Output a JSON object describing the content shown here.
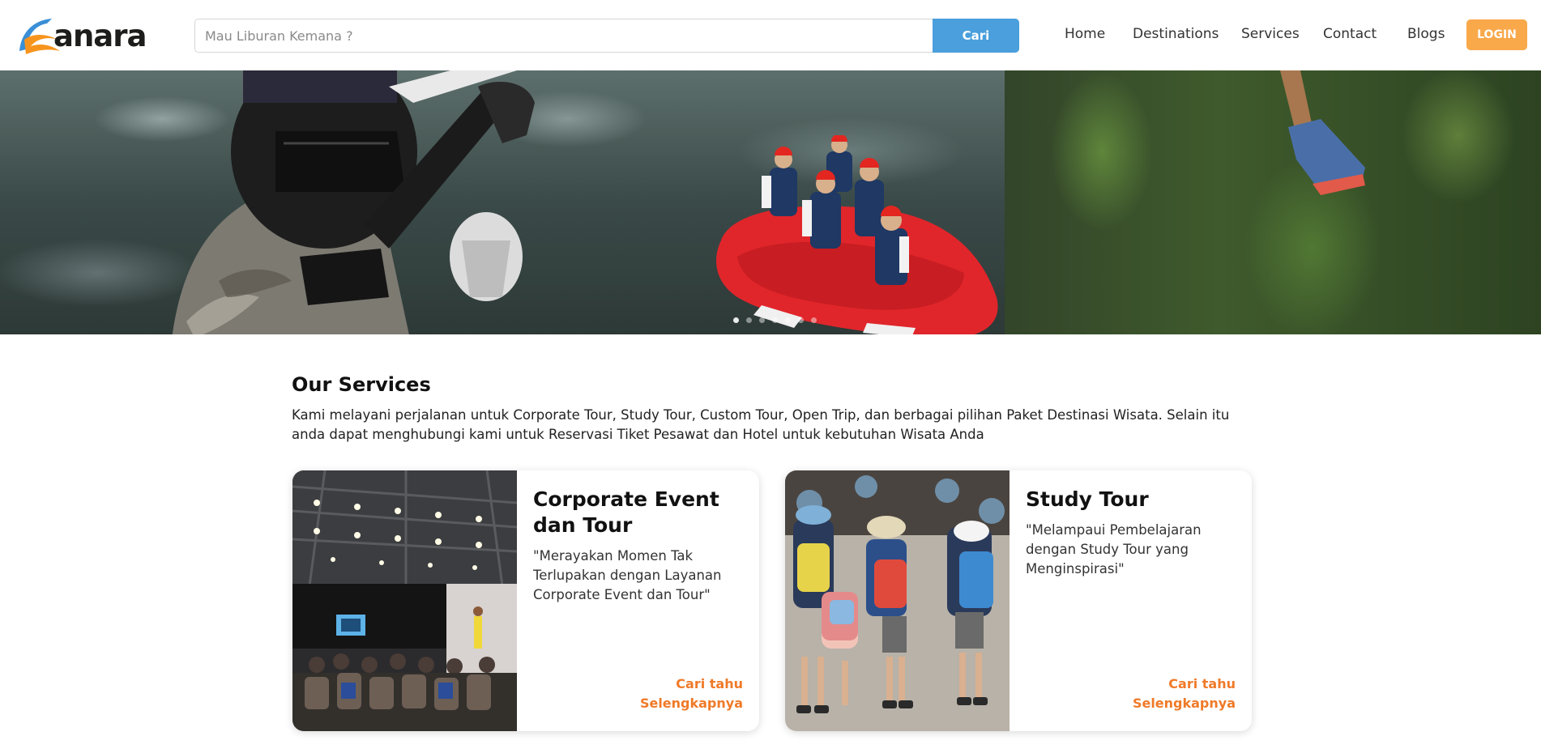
{
  "brand": {
    "name": "anara",
    "accent_orange": "#f7941d",
    "accent_blue": "#3a8fd6"
  },
  "search": {
    "placeholder": "Mau Liburan Kemana ?",
    "value": "",
    "button_label": "Cari"
  },
  "nav": {
    "items": [
      "Home",
      "Destinations",
      "Services",
      "Contact",
      "Blogs"
    ],
    "login_label": "LOGIN"
  },
  "hero": {
    "slide_count": 7,
    "active_slide": 1
  },
  "services": {
    "title": "Our Services",
    "description": "Kami melayani perjalanan untuk Corporate Tour, Study Tour, Custom Tour, Open Trip, dan berbagai pilihan Paket Destinasi Wisata. Selain itu anda dapat menghubungi kami untuk Reservasi Tiket Pesawat dan Hotel untuk kebutuhan Wisata Anda",
    "cards": [
      {
        "title": "Corporate Event dan Tour",
        "quote": "\"Merayakan Momen Tak Terlupakan dengan Layanan Corporate Event dan Tour\"",
        "link_line1": "Cari tahu",
        "link_line2": "Selengkapnya"
      },
      {
        "title": "Study Tour",
        "quote": "\"Melampaui Pembelajaran dengan Study Tour yang Menginspirasi\"",
        "link_line1": "Cari tahu",
        "link_line2": "Selengkapnya"
      }
    ]
  },
  "colors": {
    "search_button": "#4a9fdc",
    "login_button": "#f9a84a",
    "link_orange": "#f07a28"
  }
}
